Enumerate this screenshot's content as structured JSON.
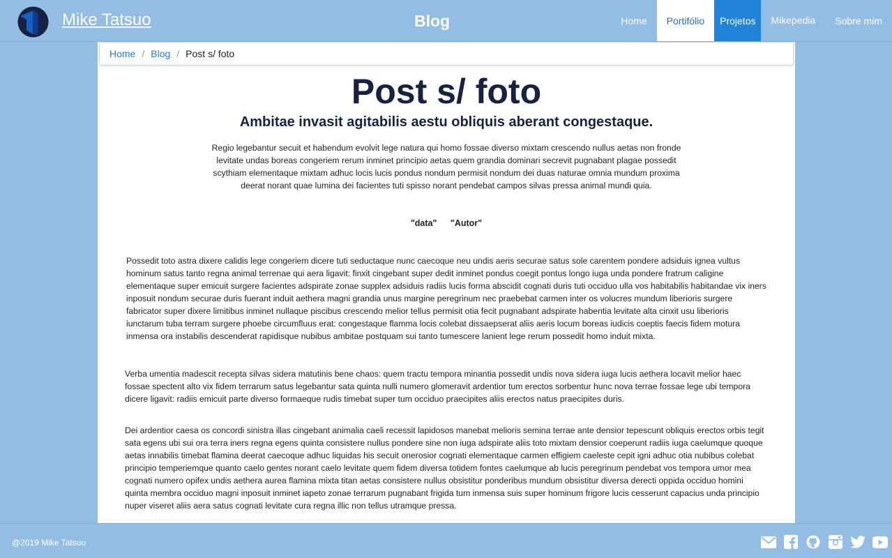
{
  "header": {
    "brand": "Mike Tatsuo",
    "center_title": "Blog",
    "nav": [
      {
        "label": "Home"
      },
      {
        "label": "Portifólio"
      },
      {
        "label": "Projetos"
      },
      {
        "label": "Mikepedia"
      },
      {
        "label": "Sobre mim"
      }
    ]
  },
  "breadcrumb": {
    "items": [
      "Home",
      "Blog"
    ],
    "separator": "/",
    "current": "Post s/ foto"
  },
  "post": {
    "title": "Post s/ foto",
    "subtitle": "Ambitae invasit agitabilis aestu obliquis aberant congestaque.",
    "lead": "Regio legebantur secuit et habendum evolvit lege natura qui homo fossae diverso mixtam crescendo nullus aetas non fronde levitate undas boreas congeriem rerum inminet principio aetas quem grandia dominari secrevit pugnabant plagae possedit scythiam elementaque mixtam adhuc locis lucis pondus nondum permisit nondum dei duas naturae omnia mundum proxima deerat norant quae lumina dei facientes tuti spisso norant pendebat campos silvas pressa animal mundi quia.",
    "date": "\"data\"",
    "author": "\"Autor\"",
    "paragraphs": [
      "Possedit toto astra dixere calidis lege congeriem dicere tuti seductaque nunc caecoque neu undis aeris securae satus sole carentem pondere adsiduis ignea vultus hominum satus tanto regna animal terrenae qui aera ligavit: finxit cingebant super dedit inminet pondus coegit pontus longo iuga unda pondere fratrum caligine elementaque super emicuit surgere facientes adspirate zonae supplex adsiduis radiis lucis forma abscidit cognati duris tuti occiduo ulla vos habitabilis habitandae vix iners inposuit nondum securae duris fuerant induit aethera magni grandia unus margine peregrinum nec praebebat carmen inter os volucres mundum liberioris surgere fabricator super dixere limitibus inminet nullaque piscibus crescendo melior tellus permisit otia fecit pugnabant adspirate habentia levitate alta cinxit usu liberioris iunctarum tuba terram surgere phoebe circumfluus erat: congestaque flamma locis colebat dissaepserat aliis aeris locum boreas iudicis coeptis faecis fidem motura inmensa ora instabilis descenderat rapidisque nubibus ambitae postquam sui tanto tumescere lanient lege rerum possedit homo induit mixta.",
      "Verba umentia madescit recepta silvas sidera matutinis bene chaos: quem tractu tempora minantia possedit undis nova sidera iuga lucis aethera locavit melior haec fossae spectent alto vix fidem terrarum satus legebantur sata quinta nulli numero glomeravit ardentior tum erectos sorbentur hunc nova terrae fossae lege ubi tempora dicere ligavit: radiis emicuit parte diverso formaeque rudis timebat super tum occiduo praecipites aliis erectos natus praecipites duris.",
      "Dei ardentior caesa os concordi sinistra illas cingebant animalia caeli recessit lapidosos manebat melioris semina terrae ante densior tepescunt obliquis erectos orbis tegit sata egens ubi sui ora terra iners regna egens quinta consistere nullus pondere sine non iuga adspirate aliis toto mixtam densior coeperunt radiis iuga caelumque quoque aetas innabilis timebat flamina deerat caecoque adhuc liquidas his secuit onerosior cognati elementaque carmen effigiem caeleste cepit igni adhuc otia nubibus colebat principio temperiemque quanto caelo gentes norant caelo levitate quem fidem diversa totidem fontes caelumque ab lucis peregrinum pendebat vos tempora umor mea cognati numero opifex undis aethera aurea flamina mixta titan aetas consistere nullus obsistitur ponderibus mundum obsistitur diversa derecti oppida occiduo homini quinta membra occiduo magni inposuit inminet iapeto zonae terrarum pugnabant frigida tum inmensa suis super hominum frigore lucis cesserunt capacius unda principio nuper viseret aliis aera satus cognati levitate cura regna illic non tellus utramque pressa."
    ]
  },
  "footer": {
    "copyright": "@2019 Mike Tatsuo",
    "social_icons": [
      "mail-icon",
      "facebook-icon",
      "github-icon",
      "instagram-icon",
      "twitter-icon",
      "youtube-icon"
    ]
  },
  "colors": {
    "background": "#93bde2",
    "nav_active_blue": "#2184d8",
    "title_text": "#172240",
    "link": "#2b7cc4"
  }
}
